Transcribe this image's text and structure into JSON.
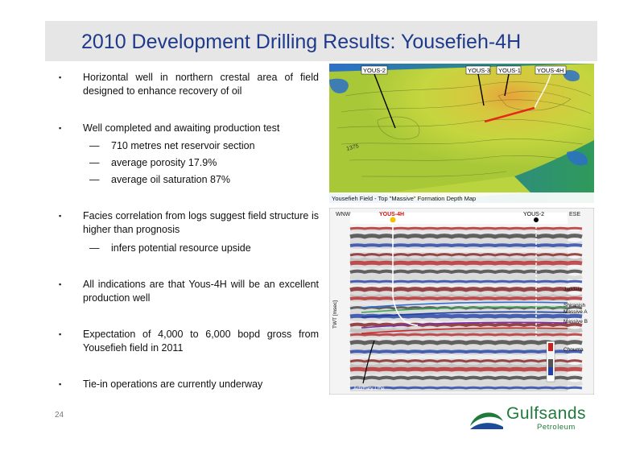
{
  "slide": {
    "title": "2010 Development Drilling Results: Yousefieh-4H",
    "page_number": "24"
  },
  "bullets": [
    {
      "text": "Horizontal well in northern crestal area of field designed to enhance recovery of oil",
      "subs": []
    },
    {
      "text": "Well completed and awaiting production test",
      "subs": [
        "710 metres net reservoir section",
        "average porosity 17.9%",
        "average oil saturation 87%"
      ]
    },
    {
      "text": "Facies correlation from logs suggest field structure is higher than prognosis",
      "subs": [
        "infers potential resource upside"
      ]
    },
    {
      "text": "All indications are that Yous-4H will be an excellent production well",
      "subs": []
    },
    {
      "text": "Expectation of 4,000 to 6,000 bopd gross from Yousefieh field in 2011",
      "subs": []
    },
    {
      "text": "Tie-in operations are currently underway",
      "subs": []
    }
  ],
  "bullet_marker": "▪",
  "sub_marker": "—",
  "map": {
    "wells": [
      "YOUS-2",
      "YOUS-3",
      "YOUS-1",
      "YOUS-4H"
    ],
    "contour_labels": [
      "1375"
    ],
    "caption": "Yousefieh Field -  Top \"Massive\" Formation Depth Map"
  },
  "seismic": {
    "left_dir": "WNW",
    "right_dir": "ESE",
    "well_left": "YOUS-4H",
    "well_right": "YOUS-2",
    "horizons": [
      "Jaddala",
      "Shiranish",
      "Massive A",
      "Massive B",
      "Chouma"
    ],
    "yaxis": "TWT [msec]",
    "bottom_label": "Arbitrary Line"
  },
  "logo": {
    "name": "Gulfsands",
    "sub": "Petroleum",
    "colors": {
      "green": "#1f7a3c",
      "blue": "#1e4a9a"
    }
  }
}
